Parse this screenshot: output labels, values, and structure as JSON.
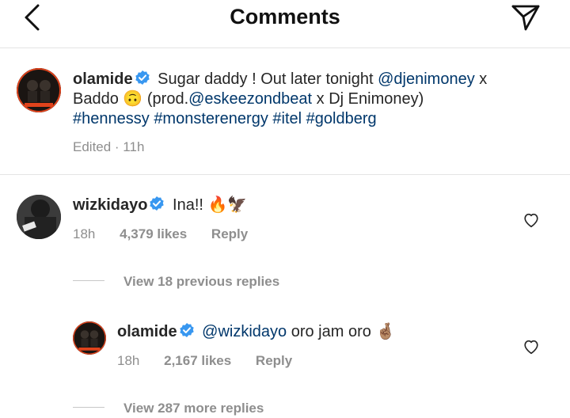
{
  "header": {
    "title": "Comments",
    "back_icon": "chevron-left-icon",
    "send_icon": "paper-plane-icon"
  },
  "caption": {
    "username": "olamide",
    "text_part1": "Sugar daddy ! Out later tonight",
    "mention1": "@djenimoney",
    "text_part2": "x",
    "text_part3": "Baddo",
    "emoji_upside_down": "🙃",
    "text_part4": "(prod.",
    "mention2": "@eskeezondbeat",
    "text_part5": "x Dj Enimoney)",
    "hashtags": [
      "#hennessy",
      "#monsterenergy",
      "#itel",
      "#goldberg"
    ],
    "meta": "Edited · 11h"
  },
  "comments": [
    {
      "username": "wizkidayo",
      "text": "Ina!!",
      "emojis": "🔥🦅",
      "time": "18h",
      "likes": "4,379 likes",
      "reply_label": "Reply",
      "view_replies": "View 18 previous replies"
    },
    {
      "username": "olamide",
      "mention": "@wizkidayo",
      "text": "oro jam oro",
      "emoji": "🤞🏽",
      "time": "18h",
      "likes": "2,167 likes",
      "reply_label": "Reply",
      "view_replies": "View 287 more replies"
    }
  ],
  "colors": {
    "link": "#00376b",
    "verified": "#3897f0",
    "muted": "#8e8e8e",
    "avatar_accent": "#e0431c"
  }
}
